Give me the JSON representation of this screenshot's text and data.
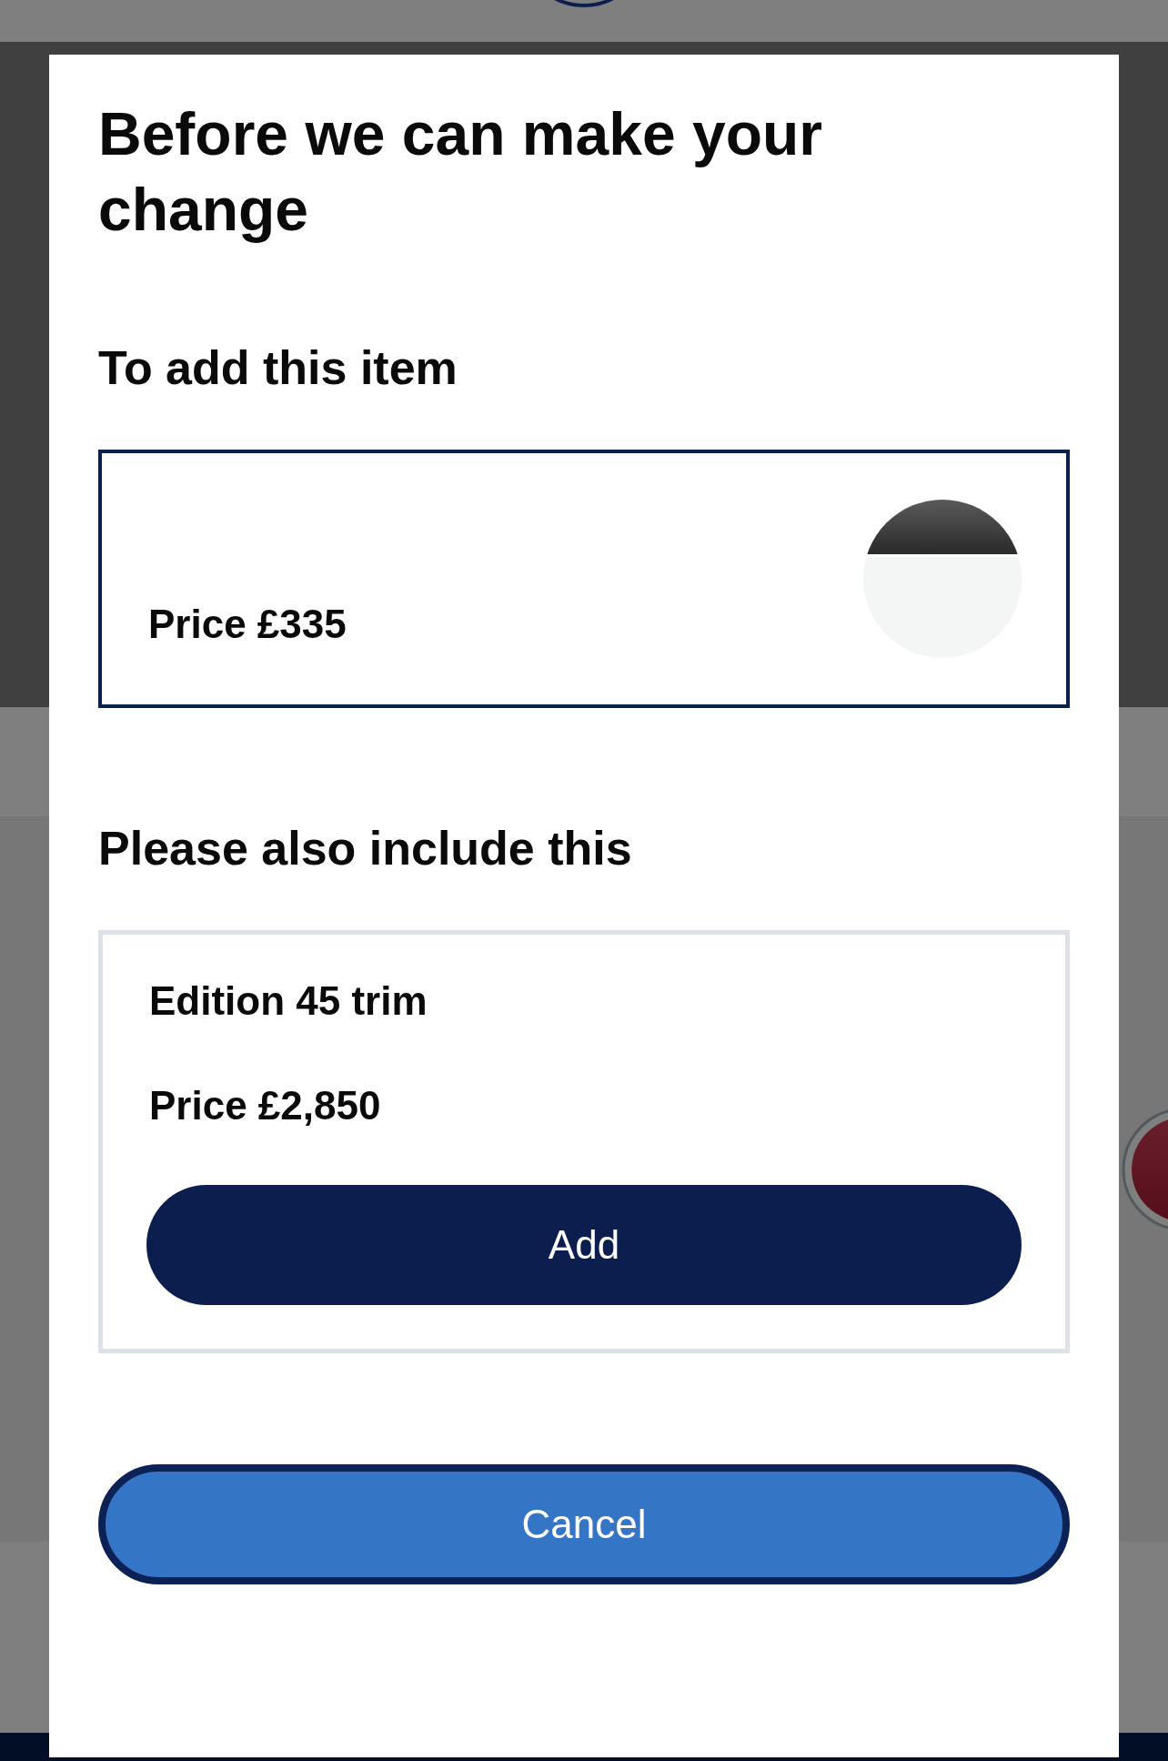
{
  "dialog": {
    "title": "Before we can make your change",
    "item_section": {
      "heading": "To add this item",
      "item": {
        "price": "Price £335"
      }
    },
    "include_section": {
      "heading": "Please also include this",
      "item": {
        "name": "Edition 45 trim",
        "price": "Price £2,850",
        "button": "Add"
      }
    },
    "cancel_button": "Cancel"
  }
}
